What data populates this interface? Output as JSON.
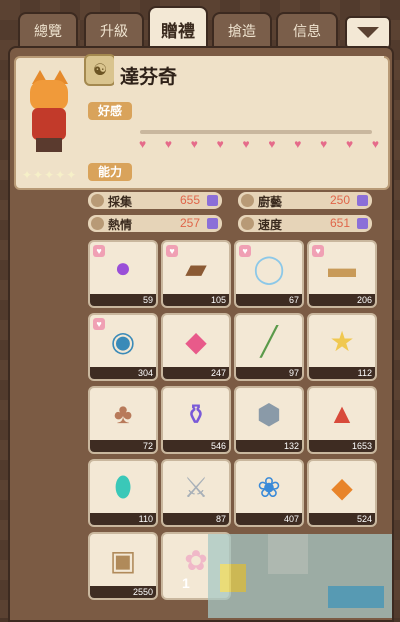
{
  "tabs": [
    {
      "label": "總覽"
    },
    {
      "label": "升級"
    },
    {
      "label": "贈禮"
    },
    {
      "label": "搶造"
    },
    {
      "label": "信息"
    }
  ],
  "character": {
    "name": "達芬奇",
    "stars": "✦✦✦✦✦"
  },
  "sections": {
    "affection": "好感",
    "ability": "能力"
  },
  "affection": {
    "level": 0.4,
    "hearts": 10
  },
  "stats": [
    {
      "label": "採集",
      "value": "655"
    },
    {
      "label": "廚藝",
      "value": "250"
    },
    {
      "label": "熱情",
      "value": "257"
    },
    {
      "label": "速度",
      "value": "651"
    }
  ],
  "items": [
    {
      "name": "crystal-ball",
      "count": "59",
      "fav": true,
      "color": "#9a4fd8"
    },
    {
      "name": "spell-book",
      "count": "105",
      "fav": true,
      "color": "#8b5a34"
    },
    {
      "name": "magic-mirror",
      "count": "67",
      "fav": true,
      "color": "#8cc8e8"
    },
    {
      "name": "scroll",
      "count": "206",
      "fav": true,
      "color": "#c89a58"
    },
    {
      "name": "yarn-ball",
      "count": "304",
      "fav": true,
      "color": "#3a8ab8"
    },
    {
      "name": "pink-crystal",
      "count": "247",
      "fav": false,
      "color": "#e85a8a"
    },
    {
      "name": "magic-staff",
      "count": "97",
      "fav": false,
      "color": "#5a9a4a"
    },
    {
      "name": "star-cloud",
      "count": "112",
      "fav": false,
      "color": "#f0c850"
    },
    {
      "name": "clover-coin",
      "count": "72",
      "fav": false,
      "color": "#b87a5a"
    },
    {
      "name": "potion",
      "count": "546",
      "fav": false,
      "color": "#7a5ad8"
    },
    {
      "name": "silver-badge",
      "count": "132",
      "fav": false,
      "color": "#8a9aa8"
    },
    {
      "name": "mushroom",
      "count": "1653",
      "fav": false,
      "color": "#d84a3a"
    },
    {
      "name": "teal-gem",
      "count": "110",
      "fav": false,
      "color": "#3ac8b8"
    },
    {
      "name": "sword",
      "count": "87",
      "fav": false,
      "color": "#a8b0b8"
    },
    {
      "name": "grapes",
      "count": "407",
      "fav": false,
      "color": "#3a8ad8"
    },
    {
      "name": "flame-crystal",
      "count": "524",
      "fav": false,
      "color": "#e8842a"
    },
    {
      "name": "sand-box",
      "count": "2550",
      "fav": false,
      "color": "#b08a5a"
    },
    {
      "name": "sakura-branch",
      "count": "",
      "fav": false,
      "color": "#f0b8c8"
    }
  ],
  "partial_count": "1",
  "colors": {
    "accent_label": "#d9a35b",
    "stat_value": "#e0664a",
    "panel_bg": "#7b5b44",
    "card_bg": "#f3e8d5"
  }
}
